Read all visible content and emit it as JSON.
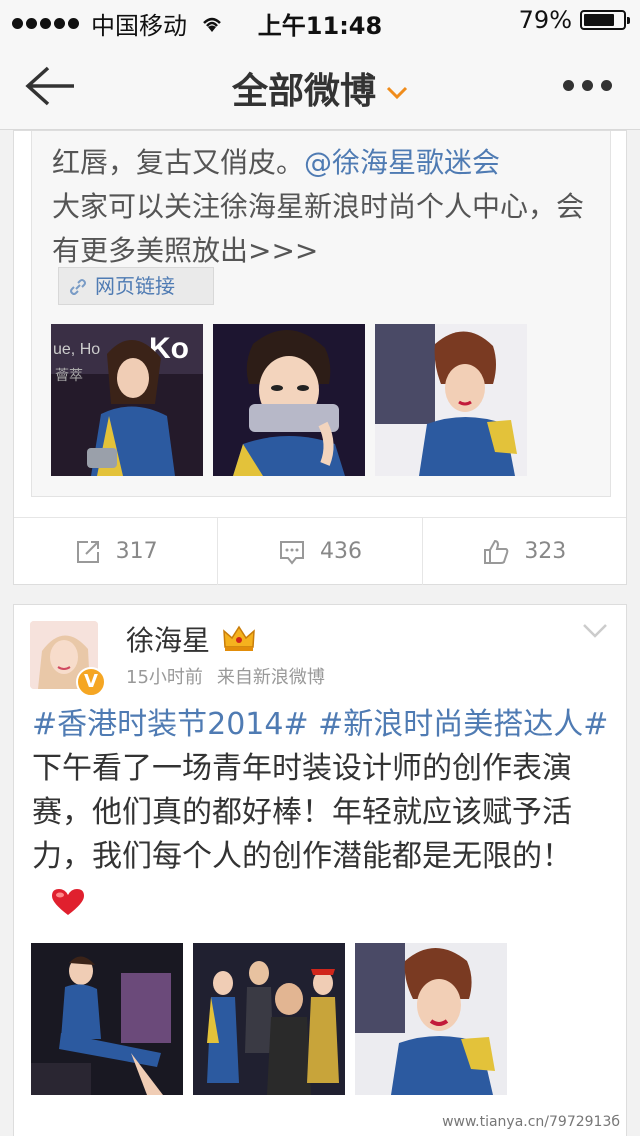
{
  "status_bar": {
    "carrier": "中国移动",
    "time": "上午11:48",
    "battery": "79%",
    "battery_level": 0.79
  },
  "nav": {
    "title": "全部微博",
    "back_icon": "arrow-left-icon",
    "more_icon": "more-dots-icon"
  },
  "post1": {
    "repost_text_line1": "红唇，复古又俏皮。",
    "mention": "@徐海星歌迷会",
    "repost_text_rest": "大家可以关注徐海星新浪时尚个人中心，会有更多美照放出>>>",
    "link_label": "网页链接",
    "image_caption_fragment_1": "ue, Ho",
    "image_caption_fragment_2": "Ko",
    "image_caption_fragment_3": "薈萃",
    "repost_count": "317",
    "comment_count": "436",
    "like_count": "323"
  },
  "post2": {
    "username": "徐海星",
    "time": "15小时前",
    "source": "来自新浪微博",
    "tag1": "#香港时装节2014#",
    "tag2": "#新浪时尚美搭达人#",
    "body": "下午看了一场青年时装设计师的创作表演赛，他们真的都好棒！年轻就应该赋予活力，我们每个人的创作潜能都是无限的！",
    "verified_badge": "V"
  },
  "watermark": "www.tianya.cn/7972913б"
}
